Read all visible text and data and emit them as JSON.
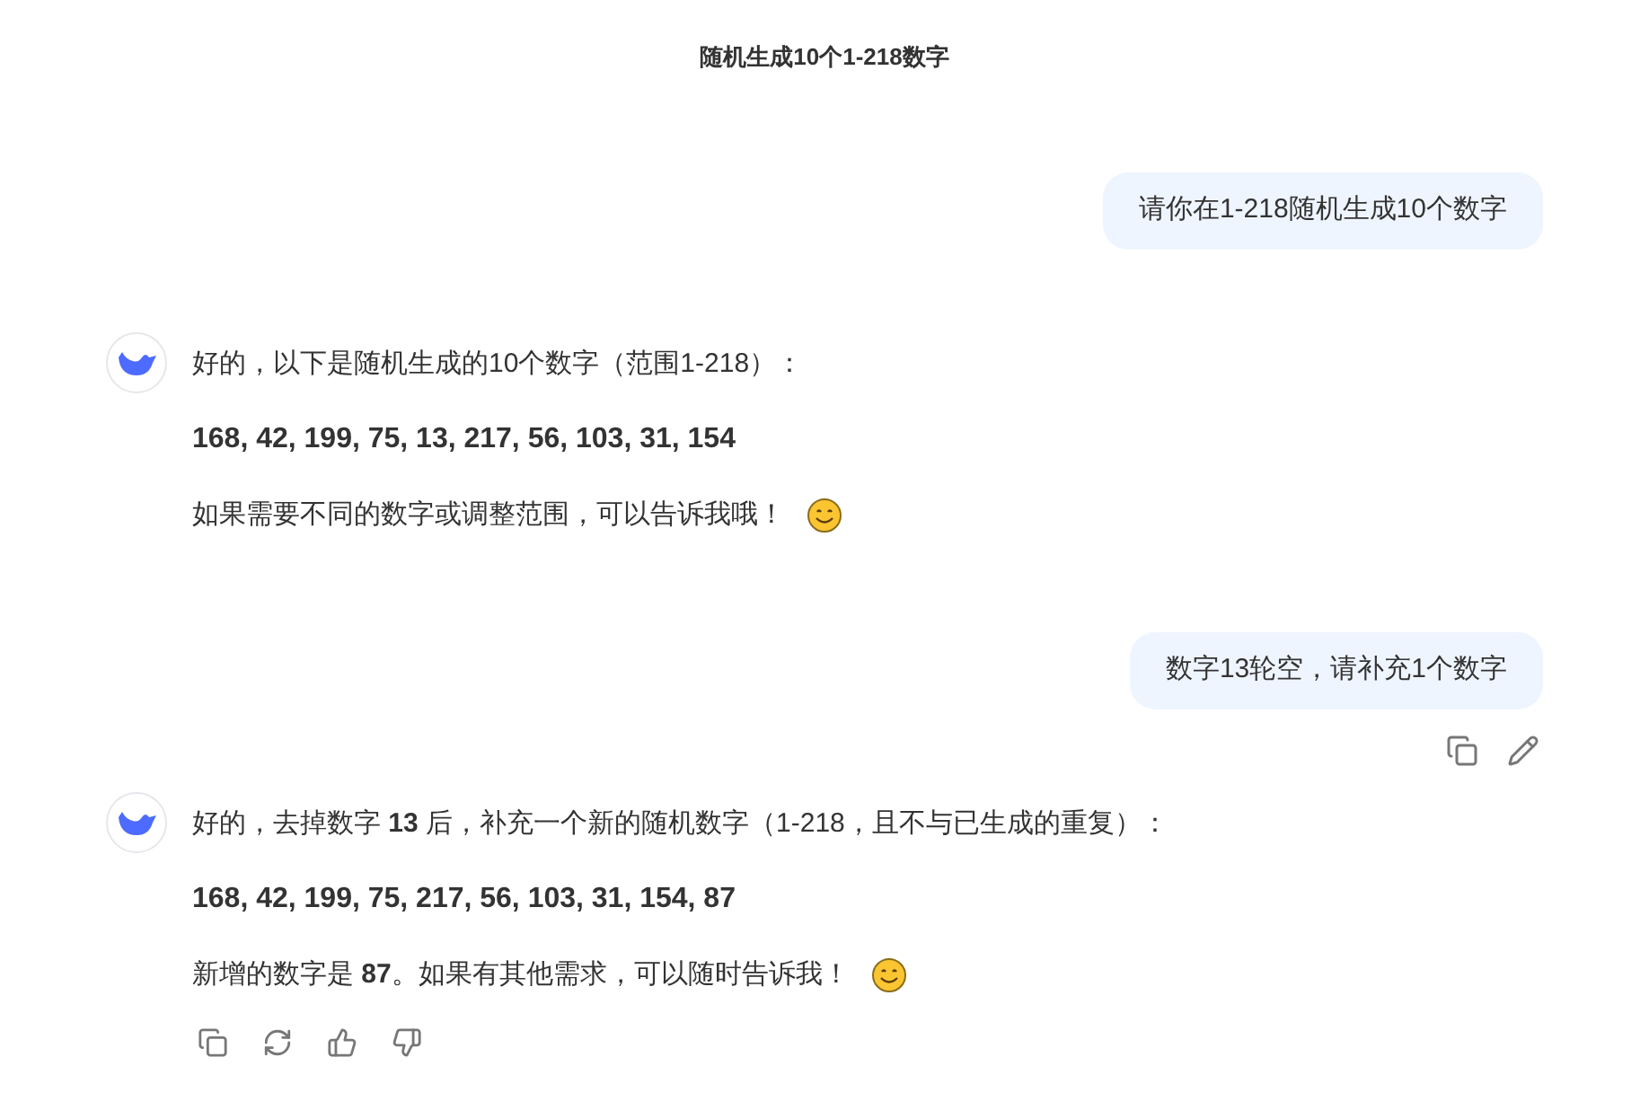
{
  "title": "随机生成10个1-218数字",
  "messages": [
    {
      "kind": "user",
      "text": "请你在1-218随机生成10个数字",
      "actions": false
    },
    {
      "kind": "assistant",
      "paragraphs": [
        {
          "kind": "text",
          "text": "好的，以下是随机生成的10个数字（范围1-218）：",
          "emoji": false
        },
        {
          "kind": "numbers",
          "text": "168, 42, 199, 75, 13, 217, 56, 103, 31, 154",
          "emoji": false
        },
        {
          "kind": "text",
          "text": "如果需要不同的数字或调整范围，可以告诉我哦！",
          "emoji": true
        }
      ],
      "actions": false
    },
    {
      "kind": "user",
      "text": "数字13轮空，请补充1个数字",
      "actions": true
    },
    {
      "kind": "assistant",
      "paragraphs": [
        {
          "kind": "text",
          "text": "好的，去掉数字 **13** 后，补充一个新的随机数字（1-218，且不与已生成的重复）：",
          "emoji": false
        },
        {
          "kind": "numbers",
          "text": "168, 42, 199, 75, 217, 56, 103, 31, 154, 87",
          "emoji": false
        },
        {
          "kind": "text",
          "text": "新增的数字是 **87**。如果有其他需求，可以随时告诉我！",
          "emoji": true
        }
      ],
      "actions": true
    }
  ]
}
